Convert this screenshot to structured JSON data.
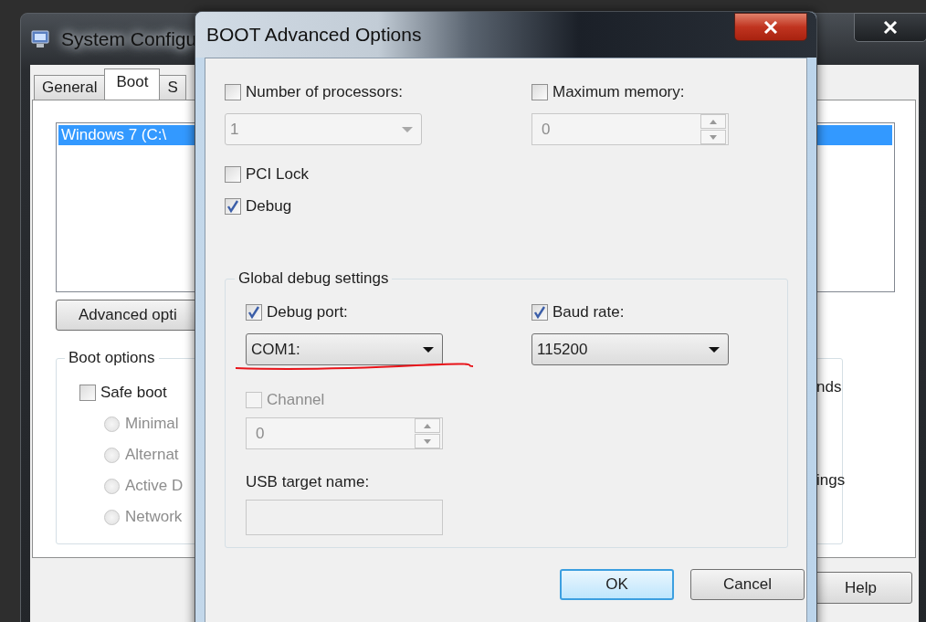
{
  "background_window": {
    "title": "System Configu",
    "tabs": [
      {
        "label": "General",
        "selected": false
      },
      {
        "label": "Boot",
        "selected": true
      },
      {
        "label": "S",
        "selected": false
      }
    ],
    "boot_list": [
      {
        "label": "Windows 7 (C:\\",
        "selected": true
      }
    ],
    "advanced_button": "Advanced opti",
    "boot_options": {
      "title": "Boot options",
      "safe_boot": {
        "label": "Safe boot",
        "checked": false
      },
      "modes": [
        {
          "label": "Minimal",
          "selected": false,
          "disabled": true
        },
        {
          "label": "Alternat",
          "selected": false,
          "disabled": true
        },
        {
          "label": "Active D",
          "selected": false,
          "disabled": true
        },
        {
          "label": "Network",
          "selected": false,
          "disabled": true
        }
      ]
    },
    "right_texts": [
      "nds",
      "ings"
    ],
    "help_button": "Help"
  },
  "dialog": {
    "title": "BOOT Advanced Options",
    "processors": {
      "label": "Number of processors:",
      "checked": false,
      "value": "1",
      "disabled": true
    },
    "max_memory": {
      "label": "Maximum memory:",
      "checked": false,
      "value": "0",
      "disabled": true
    },
    "pci_lock": {
      "label": "PCI Lock",
      "checked": false
    },
    "debug": {
      "label": "Debug",
      "checked": true
    },
    "global_debug": {
      "title": "Global debug settings",
      "debug_port": {
        "label": "Debug port:",
        "checked": true,
        "value": "COM1:"
      },
      "baud_rate": {
        "label": "Baud rate:",
        "checked": true,
        "value": "115200"
      },
      "channel": {
        "label": "Channel",
        "checked": false,
        "disabled": true,
        "value": "0"
      },
      "usb_target": {
        "label": "USB target name:"
      }
    },
    "buttons": [
      {
        "label": "OK",
        "focused": true
      },
      {
        "label": "Cancel",
        "focused": false
      }
    ]
  }
}
